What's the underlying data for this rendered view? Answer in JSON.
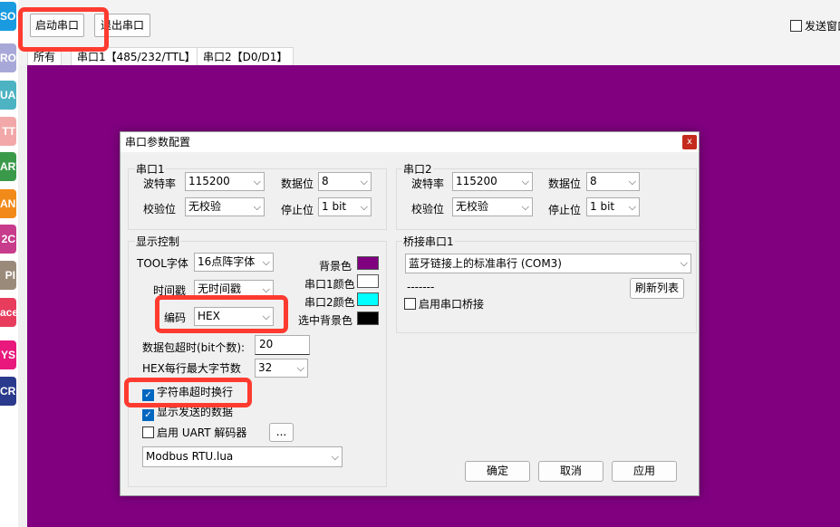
{
  "strip": [
    {
      "label": "SO",
      "color": "#1a9be0"
    },
    {
      "label": "ROG",
      "color": "#a8a8d8"
    },
    {
      "label": "UA",
      "color": "#4db3c3"
    },
    {
      "label": "TT",
      "color": "#f2a8a8"
    },
    {
      "label": "ART",
      "color": "#3a9a4a"
    },
    {
      "label": "AN",
      "color": "#f28a1a"
    },
    {
      "label": "2C",
      "color": "#c83c8c"
    },
    {
      "label": "PI",
      "color": "#9a8a7a"
    },
    {
      "label": "ace",
      "color": "#e83c5c"
    },
    {
      "label": "YS",
      "color": "#e8187c"
    },
    {
      "label": "CR",
      "color": "#2a3a8c"
    }
  ],
  "toolbar": {
    "start_label": "启动串口",
    "exit_label": "退出串口",
    "send_window_label": "发送窗口"
  },
  "tabs": [
    "所有",
    "串口1【485/232/TTL】",
    "串口2【D0/D1】"
  ],
  "dialog": {
    "title": "串口参数配置",
    "close_glyph": "x",
    "port1": {
      "group_label": "串口1",
      "baud_label": "波特率",
      "baud_value": "115200",
      "databits_label": "数据位",
      "databits_value": "8",
      "parity_label": "校验位",
      "parity_value": "无校验",
      "stopbits_label": "停止位",
      "stopbits_value": "1 bit"
    },
    "port2": {
      "group_label": "串口2",
      "baud_label": "波特率",
      "baud_value": "115200",
      "databits_label": "数据位",
      "databits_value": "8",
      "parity_label": "校验位",
      "parity_value": "无校验",
      "stopbits_label": "停止位",
      "stopbits_value": "1 bit"
    },
    "display": {
      "group_label": "显示控制",
      "font_label": "TOOL字体",
      "font_value": "16点阵字体",
      "timestamp_label": "时间戳",
      "timestamp_value": "无时间戳",
      "encoding_label": "编码",
      "encoding_value": "HEX",
      "bg_label": "背景色",
      "bg_color": "#800080",
      "port1_color_label": "串口1颜色",
      "port1_color": "#ffffff",
      "port2_color_label": "串口2颜色",
      "port2_color": "#00ffff",
      "sel_bg_label": "选中背景色",
      "sel_bg_color": "#000000",
      "timeout_label": "数据包超时(bit个数):",
      "timeout_value": "20",
      "hex_max_label": "HEX每行最大字节数",
      "hex_max_value": "32",
      "wrap_label": "字符串超时换行",
      "wrap_checked": true,
      "show_sent_label": "显示发送的数据",
      "show_sent_checked": true,
      "uart_decoder_label": "启用 UART 解码器",
      "uart_decoder_checked": false,
      "ellipsis_label": "...",
      "script_value": "Modbus RTU.lua"
    },
    "bridge": {
      "group_label": "桥接串口1",
      "port_value": "蓝牙链接上的标准串行 (COM3)",
      "dashes": "-------",
      "refresh_label": "刷新列表",
      "enable_label": "启用串口桥接",
      "enable_checked": false
    },
    "buttons": {
      "ok": "确定",
      "cancel": "取消",
      "apply": "应用"
    }
  }
}
